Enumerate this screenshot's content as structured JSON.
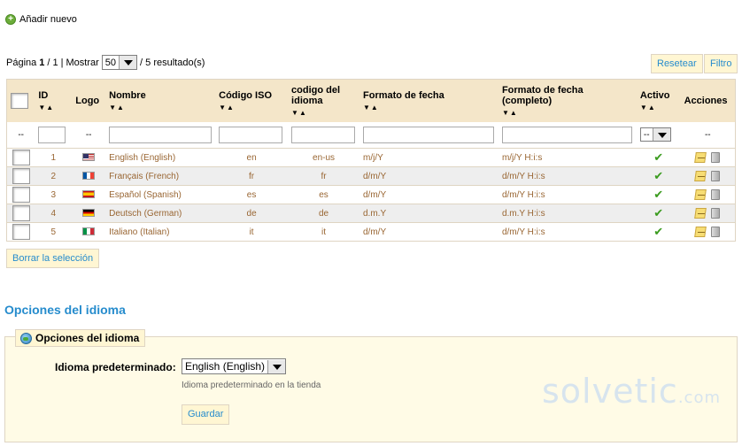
{
  "toolbar": {
    "add_new": "Añadir nuevo"
  },
  "pager": {
    "page_label": "Página",
    "page": "1",
    "sep": "/",
    "total_pages": "1",
    "show_label": "| Mostrar",
    "per_page": "50",
    "results": "/ 5 resultado(s)"
  },
  "buttons": {
    "reset": "Resetear",
    "filter": "Filtro",
    "delete_selection": "Borrar la selección",
    "save": "Guardar"
  },
  "columns": {
    "id": "ID",
    "logo": "Logo",
    "name": "Nombre",
    "iso": "Código ISO",
    "lang_code": "codigo del idioma",
    "date_format": "Formato de fecha",
    "date_format_full": "Formato de fecha (completo)",
    "active": "Activo",
    "actions": "Acciones"
  },
  "filter_row": {
    "dash": "--",
    "active_select": "--"
  },
  "rows": [
    {
      "id": "1",
      "flag": "us",
      "name": "English (English)",
      "iso": "en",
      "code": "en-us",
      "fmt": "m/j/Y",
      "fmt_full": "m/j/Y H:i:s"
    },
    {
      "id": "2",
      "flag": "fr",
      "name": "Français (French)",
      "iso": "fr",
      "code": "fr",
      "fmt": "d/m/Y",
      "fmt_full": "d/m/Y H:i:s"
    },
    {
      "id": "3",
      "flag": "es",
      "name": "Español (Spanish)",
      "iso": "es",
      "code": "es",
      "fmt": "d/m/Y",
      "fmt_full": "d/m/Y H:i:s"
    },
    {
      "id": "4",
      "flag": "de",
      "name": "Deutsch (German)",
      "iso": "de",
      "code": "de",
      "fmt": "d.m.Y",
      "fmt_full": "d.m.Y H:i:s"
    },
    {
      "id": "5",
      "flag": "it",
      "name": "Italiano (Italian)",
      "iso": "it",
      "code": "it",
      "fmt": "d/m/Y",
      "fmt_full": "d/m/Y H:i:s"
    }
  ],
  "options": {
    "section_title": "Opciones del idioma",
    "legend": "Opciones del idioma",
    "default_label": "Idioma predeterminado:",
    "default_value": "English (English)",
    "hint": "Idioma predeterminado en la tienda"
  },
  "watermark": {
    "brand": "solvetic",
    "suffix": ".com"
  }
}
